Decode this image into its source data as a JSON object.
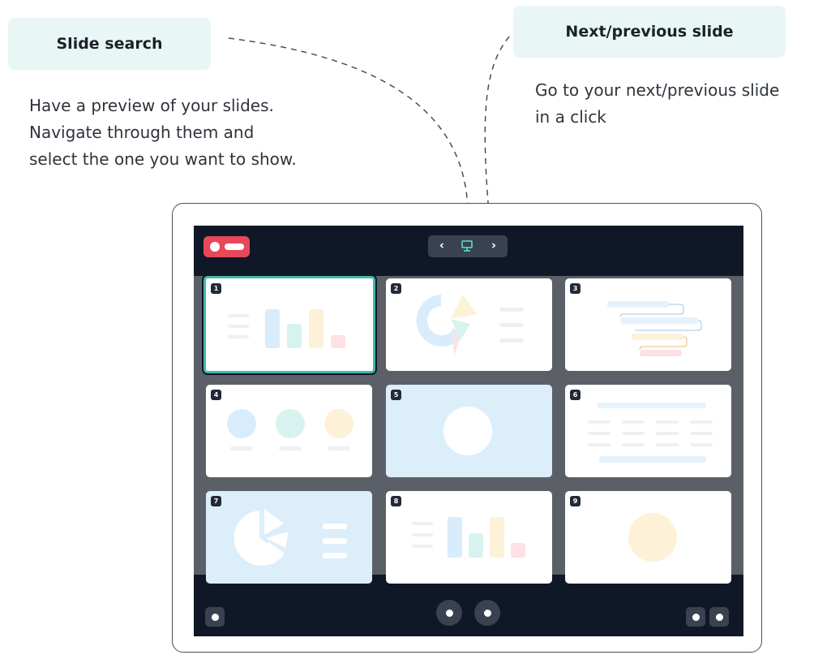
{
  "callouts": {
    "slide_search": {
      "title": "Slide search",
      "description": "Have a preview of your slides.\nNavigate through them and\nselect the one you want to show."
    },
    "next_previous": {
      "title": "Next/previous slide",
      "description": "Go to your next/previous slide\nin a click"
    }
  },
  "toolbar": {
    "prev_icon": "chevron-left-icon",
    "slides_icon": "presentation-icon",
    "next_icon": "chevron-right-icon"
  },
  "slides": [
    {
      "number": "1",
      "thumbnail": "bar-chart",
      "selected": true
    },
    {
      "number": "2",
      "thumbnail": "donut-chart"
    },
    {
      "number": "3",
      "thumbnail": "flow-lines"
    },
    {
      "number": "4",
      "thumbnail": "three-circles"
    },
    {
      "number": "5",
      "thumbnail": "single-circle"
    },
    {
      "number": "6",
      "thumbnail": "table"
    },
    {
      "number": "7",
      "thumbnail": "pie-chart"
    },
    {
      "number": "8",
      "thumbnail": "bar-chart"
    },
    {
      "number": "9",
      "thumbnail": "single-circle"
    }
  ],
  "colors": {
    "accent": "#44b8a8",
    "callout_bg": "#e8f7f5",
    "screen_bg": "#101827",
    "record": "#e9485a"
  }
}
